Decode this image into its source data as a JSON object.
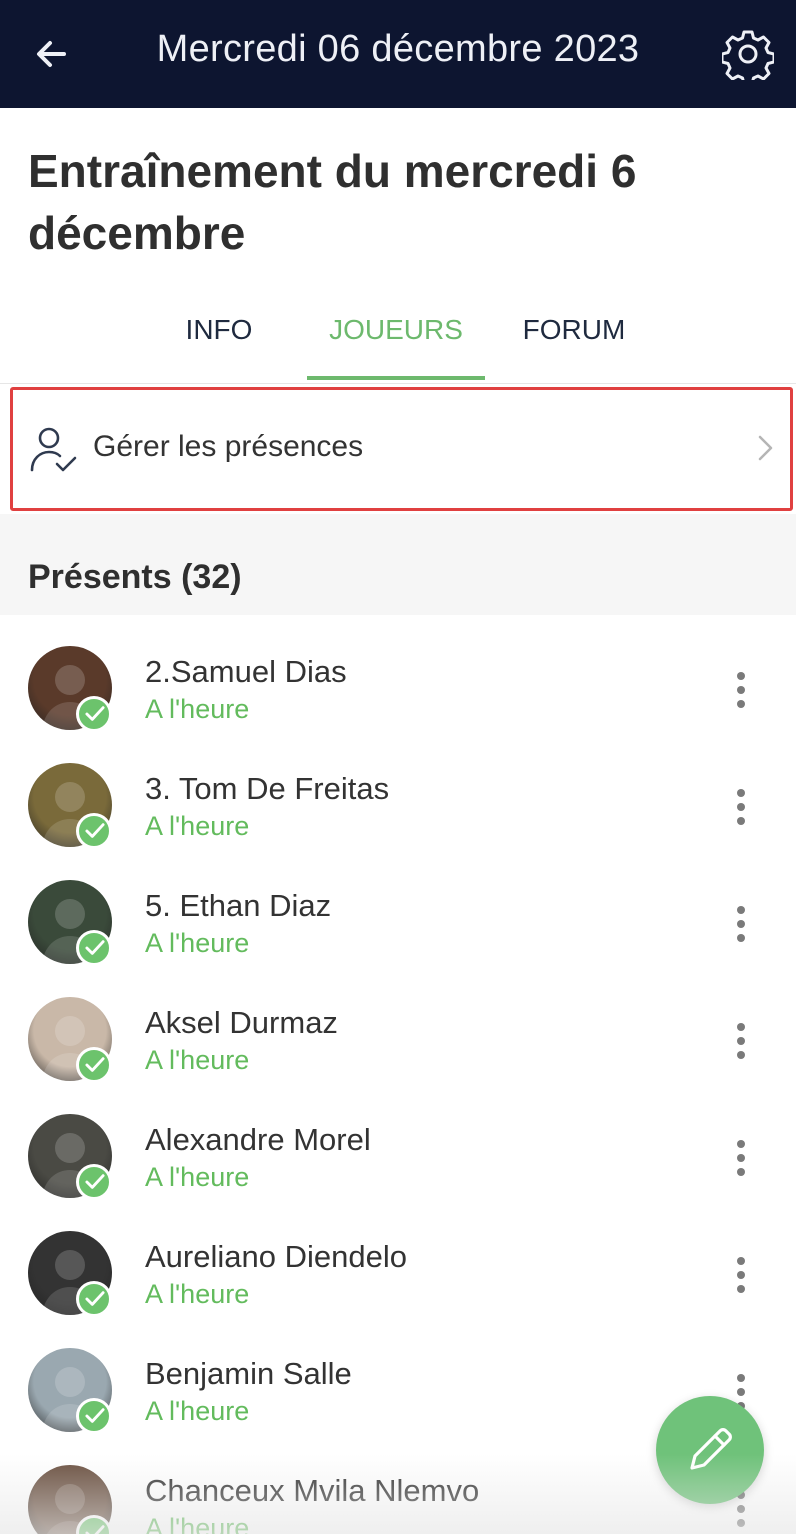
{
  "header": {
    "title": "Mercredi 06 décembre 2023",
    "back_icon": "arrow-left-icon",
    "settings_icon": "gear-icon",
    "background": "#0d1530"
  },
  "event": {
    "title": "Entraînement du mercredi 6 décembre"
  },
  "tabs": [
    {
      "label": "INFO",
      "active": false
    },
    {
      "label": "JOUEURS",
      "active": true
    },
    {
      "label": "FORUM",
      "active": false
    }
  ],
  "manage": {
    "label": "Gérer les présences",
    "icon": "person-check-icon"
  },
  "section": {
    "title": "Présents (32)"
  },
  "players": [
    {
      "name": "2.Samuel Dias",
      "status": "A l'heure",
      "avatar": "#5a3a2a"
    },
    {
      "name": "3. Tom De Freitas",
      "status": "A l'heure",
      "avatar": "#7a6a3a"
    },
    {
      "name": "5. Ethan Diaz",
      "status": "A l'heure",
      "avatar": "#3a4a3a"
    },
    {
      "name": "Aksel Durmaz",
      "status": "A l'heure",
      "avatar": "#c9b8a8"
    },
    {
      "name": "Alexandre Morel",
      "status": "A l'heure",
      "avatar": "#4a4a44"
    },
    {
      "name": "Aureliano Diendelo",
      "status": "A l'heure",
      "avatar": "#333333"
    },
    {
      "name": "Benjamin Salle",
      "status": "A l'heure",
      "avatar": "#9aa8b0"
    },
    {
      "name": "Chanceux Mvila Nlemvo",
      "status": "A l'heure",
      "avatar": "#6a5040"
    }
  ],
  "colors": {
    "accent_green": "#6db96d",
    "status_green": "#63bb5d",
    "highlight_red": "#e04040"
  },
  "fab_icon": "pencil-icon"
}
